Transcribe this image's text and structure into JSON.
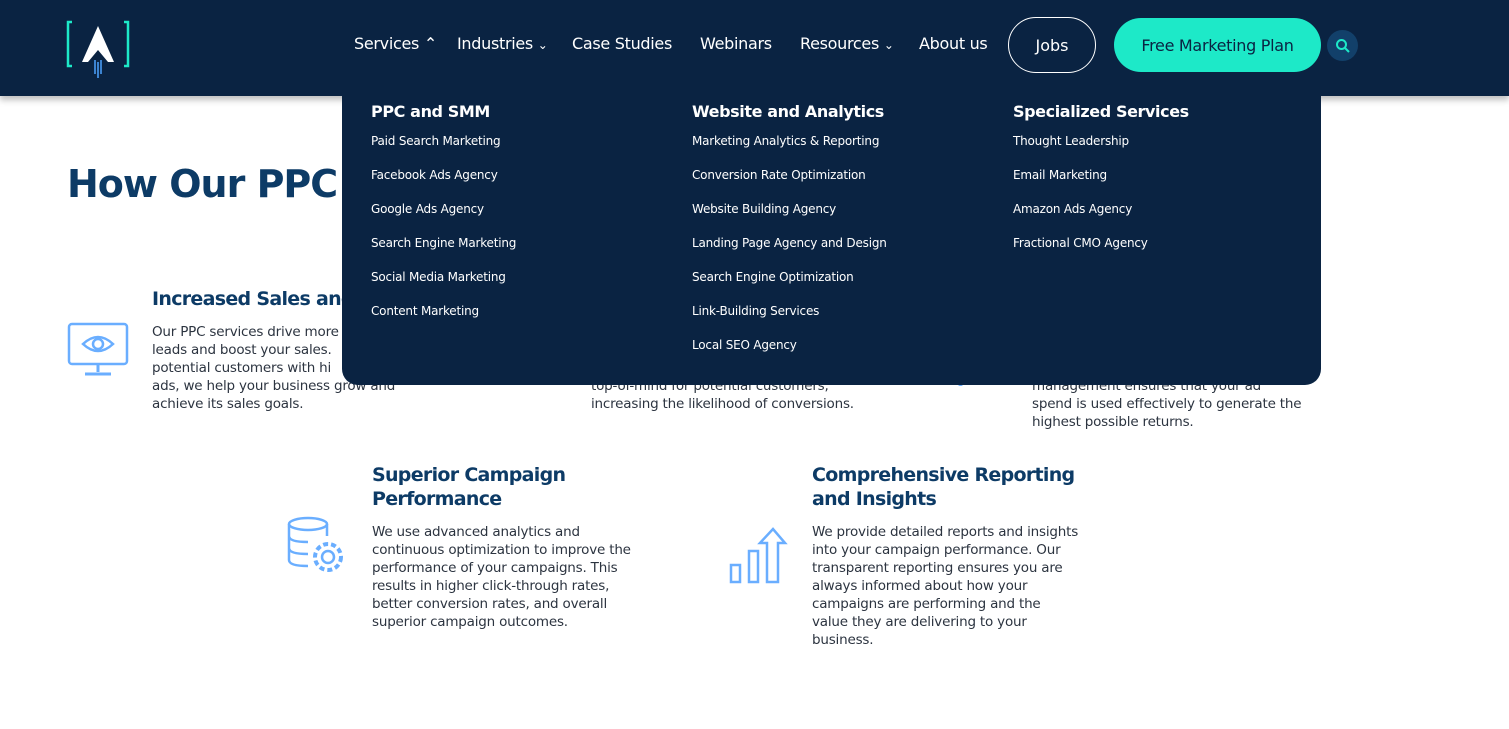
{
  "header": {
    "nav": [
      {
        "label": "Services",
        "chevron": "up"
      },
      {
        "label": "Industries",
        "chevron": "down"
      },
      {
        "label": "Case Studies"
      },
      {
        "label": "Webinars"
      },
      {
        "label": "Resources",
        "chevron": "down"
      },
      {
        "label": "About us"
      }
    ],
    "jobs_label": "Jobs",
    "cta_label": "Free Marketing Plan",
    "colors": {
      "bg": "#0a2342",
      "accent": "#1de9c8"
    }
  },
  "dropdown": {
    "columns": [
      {
        "heading": "PPC and SMM",
        "items": [
          "Paid Search Marketing",
          "Facebook Ads Agency",
          "Google Ads Agency",
          "Search Engine Marketing",
          "Social Media Marketing",
          "Content Marketing"
        ]
      },
      {
        "heading": "Website and Analytics",
        "items": [
          "Marketing Analytics & Reporting",
          "Conversion Rate Optimization",
          "Website Building Agency",
          "Landing Page Agency and Design",
          "Search Engine Optimization",
          "Link-Building Services",
          "Local SEO Agency"
        ]
      },
      {
        "heading": "Specialized Services",
        "items": [
          "Thought Leadership",
          "Email Marketing",
          "Amazon Ads Agency",
          "Fractional CMO Agency"
        ]
      }
    ]
  },
  "main": {
    "title": "How Our PPC S",
    "features": [
      {
        "title": "Increased Sales and",
        "lines": [
          "Our PPC services drive more",
          "leads and boost your sales.",
          "potential customers with hi",
          "ads, we help your business grow and",
          "achieve its sales goals."
        ],
        "icon": "monitor-eye-icon"
      },
      {
        "lines": [
          "top-of-mind for potential customers,",
          "increasing the likelihood of conversions."
        ]
      },
      {
        "lines": [
          "management ensures that your ad",
          "spend is used effectively to generate the",
          "highest possible returns."
        ]
      },
      {
        "title": "Superior Campaign Performance",
        "title_lines": [
          "Superior Campaign",
          "Performance"
        ],
        "lines": [
          "We use advanced analytics and",
          "continuous optimization to improve the",
          "performance of your campaigns. This",
          "results in higher click-through rates,",
          "better conversion rates, and overall",
          "superior campaign outcomes."
        ],
        "icon": "database-gear-icon"
      },
      {
        "title_lines": [
          "Comprehensive Reporting",
          "and Insights"
        ],
        "lines": [
          "We provide detailed reports and insights",
          "into your campaign performance. Our",
          "transparent reporting ensures you are",
          "always informed about how your",
          "campaigns are performing and the",
          "value they are delivering to your",
          "business."
        ],
        "icon": "bar-chart-arrow-icon"
      }
    ]
  }
}
